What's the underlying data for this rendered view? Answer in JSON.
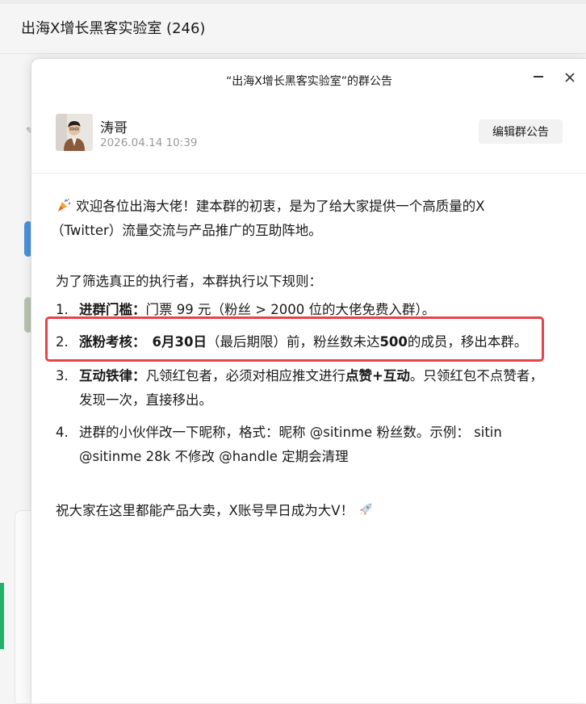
{
  "window": {
    "title": "出海X增长黑客实验室 (246)"
  },
  "dialog": {
    "title": "“出海X增长黑客实验室”的群公告",
    "author_name": "涛哥",
    "post_time": "2026.04.14 10:39",
    "edit_button": "编辑群公告"
  },
  "announcement": {
    "intro_line1": "欢迎各位出海大佬！建本群的初衷，是为了给大家提供一个高质量的X",
    "intro_line2": "（Twitter）流量交流与产品推广的互助阵地。",
    "rules_intro": "为了筛选真正的执行者，本群执行以下规则：",
    "rules": [
      {
        "num": "1.",
        "title": "进群门槛：",
        "text": "门票 99 元（粉丝 > 2000 位的大佬免费入群）。"
      },
      {
        "num": "2.",
        "title": "涨粉考核：",
        "deadline": "6月30日",
        "text_a": "（最后期限）前，粉丝数未达",
        "threshold": "500",
        "text_b": "的成员，移出本群。"
      },
      {
        "num": "3.",
        "title": "互动铁律：",
        "text_a": "凡领红包者，必须对相应推文进行",
        "emphasis": "点赞+互动",
        "text_b": "。只领红包不点赞者，",
        "line2": "发现一次，直接移出。"
      },
      {
        "num": "4.",
        "line1": "进群的小伙伴改一下昵称，格式：昵称 @sitinme 粉丝数。示例： sitin",
        "line2": "@sitinme 28k  不修改 @handle 定期会清理"
      }
    ],
    "closing": "祝大家在这里都能产品大卖，X账号早日成为大V！"
  },
  "icons": {
    "intro_emoji": "party-popper-icon",
    "closing_emoji": "rocket-icon",
    "close": "close-icon",
    "minimize": "minimize-icon"
  },
  "colors": {
    "highlight_border": "#e5444a",
    "accent_green": "#20b26b"
  }
}
